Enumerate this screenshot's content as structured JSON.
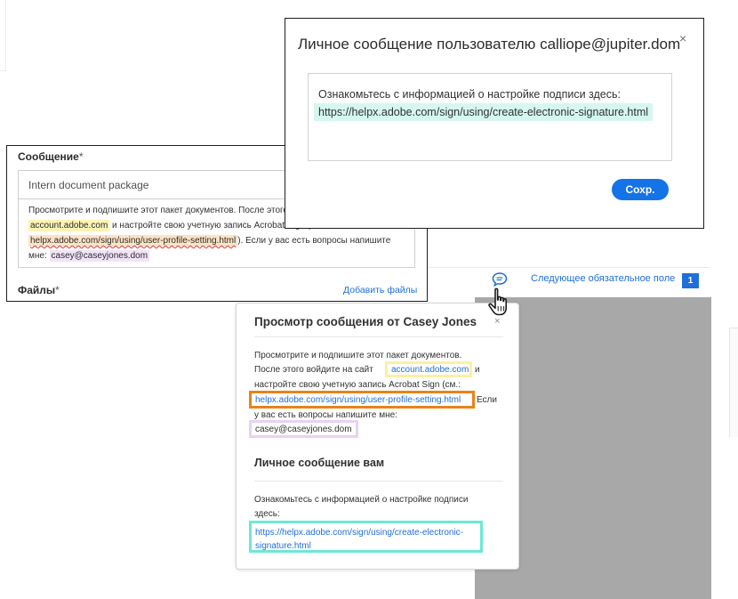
{
  "private_dialog": {
    "title": "Личное сообщение пользователю calliope@jupiter.dom",
    "close_label": "×",
    "line1": "Ознакомьтесь с информацией о настройке подписи здесь:",
    "link": "https://helpx.adobe.com/sign/using/create-electronic-signature.html",
    "save_label": "Сохр.",
    "accent_color": "#1473e6"
  },
  "message_panel": {
    "label": "Сообщение",
    "asterisk": "*",
    "subject": "Intern document package",
    "body": {
      "line1": "Просмотрите и подпишите этот пакет документов. После этого войдите на сайт",
      "line2_link": "account.adobe.com",
      "line2_text": " и настройте свою учетную запись Acrobat Sign (см.:",
      "line3_link": "helpx.adobe.com/sign/using/user-profile-setting.html",
      "line3_text": "). Если у вас есть вопросы напишите",
      "line4_text": "мне: ",
      "line4_email": "casey@caseyjones.dom"
    },
    "files_label": "Файлы",
    "files_asterisk": "*",
    "add_files_label": "Добавить файлы"
  },
  "toolbar": {
    "chat_icon": "chat-bubble-icon",
    "next_field_label": "Следующее обязательное поле",
    "next_field_count": "1",
    "cursor_icon": "hand-pointer-icon"
  },
  "preview": {
    "title": "Просмотр сообщения от Casey Jones",
    "close_label": "×",
    "line1": "Просмотрите и подпишите этот пакет документов.",
    "line2": "После этого войдите на сайт",
    "account_link": "account.adobe.com",
    "line2_tail": "и",
    "line3": "настройте свою учетную запись Acrobat Sign (см.:",
    "profile_link": "helpx.adobe.com/sign/using/user-profile-setting.html",
    "line4_tail": "Если",
    "line5": "у вас есть вопросы напишите мне:",
    "email": "casey@caseyjones.dom",
    "private_title": "Личное сообщение вам",
    "private_line1": "Ознакомьтесь с информацией о настройке подписи",
    "private_line2": "здесь:",
    "private_link_line1": "https://helpx.adobe.com/sign/using/create-electronic-",
    "private_link_line2": "signature.html"
  },
  "colors": {
    "highlight_yellow": "#fdf0a0",
    "highlight_orange": "#e8831a",
    "highlight_lilac": "#e8d2f4",
    "highlight_cyan": "#6ce8d6",
    "link_blue": "#1e6fd9"
  }
}
